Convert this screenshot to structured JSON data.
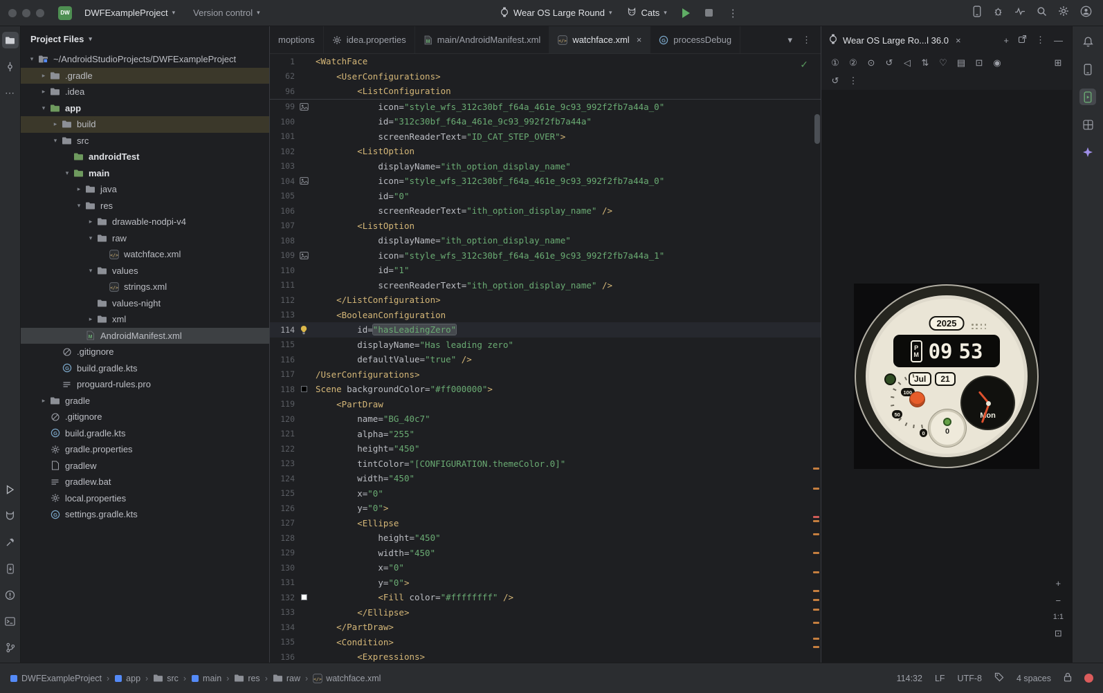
{
  "colors": {
    "accent_blue": "#548af7",
    "run_green": "#5fad65",
    "warning_orange": "#c57e3f",
    "error_red": "#db5c5c",
    "tag_gold": "#d5b778",
    "value_green": "#6aab73"
  },
  "titlebar": {
    "logo_text": "DW",
    "project_name": "DWFExampleProject",
    "vcs_label": "Version control",
    "device_selector_label": "Wear OS Large Round",
    "run_config_label": "Cats"
  },
  "left_strip": {
    "top": [
      {
        "name": "project-tool-icon",
        "active": true
      },
      {
        "name": "commit-tool-icon",
        "active": false
      },
      {
        "name": "more-tool-windows-icon",
        "active": false
      }
    ],
    "bottom": [
      {
        "name": "run-tool-icon"
      },
      {
        "name": "logcat-tool-icon"
      },
      {
        "name": "build-tool-icon"
      },
      {
        "name": "device-explorer-tool-icon"
      },
      {
        "name": "problems-tool-icon"
      },
      {
        "name": "terminal-tool-icon"
      },
      {
        "name": "version-control-tool-icon"
      }
    ]
  },
  "project_panel": {
    "title": "Project Files",
    "tree": [
      {
        "label": "~/AndroidStudioProjects/DWFExampleProject",
        "depth": 0,
        "icon": "project",
        "chev": "down"
      },
      {
        "label": ".gradle",
        "depth": 1,
        "icon": "folder",
        "chev": "right",
        "bg": "excluded"
      },
      {
        "label": ".idea",
        "depth": 1,
        "icon": "folder",
        "chev": "right"
      },
      {
        "label": "app",
        "depth": 1,
        "icon": "folder-green",
        "chev": "down",
        "bold": true
      },
      {
        "label": "build",
        "depth": 2,
        "icon": "folder",
        "chev": "right",
        "bg": "excluded"
      },
      {
        "label": "src",
        "depth": 2,
        "icon": "folder",
        "chev": "down"
      },
      {
        "label": "androidTest",
        "depth": 3,
        "icon": "folder-green",
        "chev": null,
        "bold": true
      },
      {
        "label": "main",
        "depth": 3,
        "icon": "folder-green",
        "chev": "down",
        "bold": true
      },
      {
        "label": "java",
        "depth": 4,
        "icon": "folder",
        "chev": "right"
      },
      {
        "label": "res",
        "depth": 4,
        "icon": "folder",
        "chev": "down"
      },
      {
        "label": "drawable-nodpi-v4",
        "depth": 5,
        "icon": "folder",
        "chev": "right"
      },
      {
        "label": "raw",
        "depth": 5,
        "icon": "folder",
        "chev": "down"
      },
      {
        "label": "watchface.xml",
        "depth": 6,
        "icon": "xml",
        "chev": null
      },
      {
        "label": "values",
        "depth": 5,
        "icon": "folder",
        "chev": "down"
      },
      {
        "label": "strings.xml",
        "depth": 6,
        "icon": "xml",
        "chev": null
      },
      {
        "label": "values-night",
        "depth": 5,
        "icon": "folder",
        "chev": null
      },
      {
        "label": "xml",
        "depth": 5,
        "icon": "folder",
        "chev": "right"
      },
      {
        "label": "AndroidManifest.xml",
        "depth": 4,
        "icon": "manifest",
        "chev": null,
        "bg": "selected"
      },
      {
        "label": ".gitignore",
        "depth": 2,
        "icon": "gitignore",
        "chev": null
      },
      {
        "label": "build.gradle.kts",
        "depth": 2,
        "icon": "gradle",
        "chev": null
      },
      {
        "label": "proguard-rules.pro",
        "depth": 2,
        "icon": "textfile",
        "chev": null
      },
      {
        "label": "gradle",
        "depth": 1,
        "icon": "folder",
        "chev": "right"
      },
      {
        "label": ".gitignore",
        "depth": 1,
        "icon": "gitignore",
        "chev": null
      },
      {
        "label": "build.gradle.kts",
        "depth": 1,
        "icon": "gradle",
        "chev": null
      },
      {
        "label": "gradle.properties",
        "depth": 1,
        "icon": "props",
        "chev": null
      },
      {
        "label": "gradlew",
        "depth": 1,
        "icon": "file",
        "chev": null
      },
      {
        "label": "gradlew.bat",
        "depth": 1,
        "icon": "textfile",
        "chev": null
      },
      {
        "label": "local.properties",
        "depth": 1,
        "icon": "props",
        "chev": null
      },
      {
        "label": "settings.gradle.kts",
        "depth": 1,
        "icon": "gradle",
        "chev": null
      }
    ]
  },
  "tabs": {
    "items": [
      {
        "label": "moptions",
        "icon": null,
        "active": false
      },
      {
        "label": "idea.properties",
        "icon": "props",
        "active": false
      },
      {
        "label": "main/AndroidManifest.xml",
        "icon": "manifest",
        "active": false
      },
      {
        "label": "watchface.xml",
        "icon": "xml",
        "active": true,
        "closable": true
      },
      {
        "label": "processDebug",
        "icon": "gradle",
        "active": false
      }
    ]
  },
  "editor": {
    "sticky_lines": [
      {
        "n": 1,
        "ind": 0,
        "toks": [
          [
            "t",
            "<WatchFace"
          ]
        ]
      },
      {
        "n": 62,
        "ind": 4,
        "toks": [
          [
            "t",
            "<UserConfigurations>"
          ]
        ]
      },
      {
        "n": 96,
        "ind": 8,
        "toks": [
          [
            "t",
            "<ListConfiguration"
          ]
        ]
      }
    ],
    "lines": [
      {
        "n": 99,
        "ind": 12,
        "g": "image",
        "toks": [
          [
            "a",
            "icon="
          ],
          [
            "v",
            "\"style_wfs_312c30bf_f64a_461e_9c93_992f2fb7a44a_0\""
          ]
        ]
      },
      {
        "n": 100,
        "ind": 12,
        "toks": [
          [
            "a",
            "id="
          ],
          [
            "v",
            "\"312c30bf_f64a_461e_9c93_992f2fb7a44a\""
          ]
        ]
      },
      {
        "n": 101,
        "ind": 12,
        "toks": [
          [
            "a",
            "screenReaderText="
          ],
          [
            "v",
            "\"ID_CAT_STEP_OVER\""
          ],
          [
            "t",
            ">"
          ]
        ]
      },
      {
        "n": 102,
        "ind": 8,
        "toks": [
          [
            "t",
            "<ListOption"
          ]
        ]
      },
      {
        "n": 103,
        "ind": 12,
        "toks": [
          [
            "a",
            "displayName="
          ],
          [
            "v",
            "\"ith_option_display_name\""
          ]
        ]
      },
      {
        "n": 104,
        "ind": 12,
        "g": "image",
        "toks": [
          [
            "a",
            "icon="
          ],
          [
            "v",
            "\"style_wfs_312c30bf_f64a_461e_9c93_992f2fb7a44a_0\""
          ]
        ]
      },
      {
        "n": 105,
        "ind": 12,
        "toks": [
          [
            "a",
            "id="
          ],
          [
            "v",
            "\"0\""
          ]
        ]
      },
      {
        "n": 106,
        "ind": 12,
        "toks": [
          [
            "a",
            "screenReaderText="
          ],
          [
            "v",
            "\"ith_option_display_name\""
          ],
          [
            "p",
            " "
          ],
          [
            "t",
            "/>"
          ]
        ]
      },
      {
        "n": 107,
        "ind": 8,
        "toks": [
          [
            "t",
            "<ListOption"
          ]
        ]
      },
      {
        "n": 108,
        "ind": 12,
        "toks": [
          [
            "a",
            "displayName="
          ],
          [
            "v",
            "\"ith_option_display_name\""
          ]
        ]
      },
      {
        "n": 109,
        "ind": 12,
        "g": "image",
        "toks": [
          [
            "a",
            "icon="
          ],
          [
            "v",
            "\"style_wfs_312c30bf_f64a_461e_9c93_992f2fb7a44a_1\""
          ]
        ]
      },
      {
        "n": 110,
        "ind": 12,
        "toks": [
          [
            "a",
            "id="
          ],
          [
            "v",
            "\"1\""
          ]
        ]
      },
      {
        "n": 111,
        "ind": 12,
        "toks": [
          [
            "a",
            "screenReaderText="
          ],
          [
            "v",
            "\"ith_option_display_name\""
          ],
          [
            "p",
            " "
          ],
          [
            "t",
            "/>"
          ]
        ]
      },
      {
        "n": 112,
        "ind": 4,
        "toks": [
          [
            "t",
            "</ListConfiguration>"
          ]
        ]
      },
      {
        "n": 113,
        "ind": 4,
        "toks": [
          [
            "t",
            "<BooleanConfiguration"
          ]
        ]
      },
      {
        "n": 114,
        "ind": 8,
        "g": "bulb",
        "cur": true,
        "toks": [
          [
            "a",
            "id="
          ],
          [
            "h",
            "\"hasLeadingZero\""
          ]
        ]
      },
      {
        "n": 115,
        "ind": 8,
        "toks": [
          [
            "a",
            "displayName="
          ],
          [
            "v",
            "\"Has leading zero\""
          ]
        ]
      },
      {
        "n": 116,
        "ind": 8,
        "toks": [
          [
            "a",
            "defaultValue="
          ],
          [
            "v",
            "\"true\""
          ],
          [
            "p",
            " "
          ],
          [
            "t",
            "/>"
          ]
        ]
      },
      {
        "n": 117,
        "ind": 0,
        "toks": [
          [
            "t",
            "/UserConfigurations>"
          ]
        ]
      },
      {
        "n": 118,
        "ind": 0,
        "g": "sw-black",
        "toks": [
          [
            "t",
            "Scene"
          ],
          [
            "p",
            " "
          ],
          [
            "a",
            "backgroundColor="
          ],
          [
            "v",
            "\"#ff000000\""
          ],
          [
            "t",
            ">"
          ]
        ]
      },
      {
        "n": 119,
        "ind": 4,
        "toks": [
          [
            "t",
            "<PartDraw"
          ]
        ]
      },
      {
        "n": 120,
        "ind": 8,
        "toks": [
          [
            "a",
            "name="
          ],
          [
            "v",
            "\"BG_40c7\""
          ]
        ]
      },
      {
        "n": 121,
        "ind": 8,
        "toks": [
          [
            "a",
            "alpha="
          ],
          [
            "v",
            "\"255\""
          ]
        ]
      },
      {
        "n": 122,
        "ind": 8,
        "toks": [
          [
            "a",
            "height="
          ],
          [
            "v",
            "\"450\""
          ]
        ]
      },
      {
        "n": 123,
        "ind": 8,
        "toks": [
          [
            "a",
            "tintColor="
          ],
          [
            "v",
            "\"[CONFIGURATION.themeColor.0]\""
          ]
        ]
      },
      {
        "n": 124,
        "ind": 8,
        "toks": [
          [
            "a",
            "width="
          ],
          [
            "v",
            "\"450\""
          ]
        ]
      },
      {
        "n": 125,
        "ind": 8,
        "toks": [
          [
            "a",
            "x="
          ],
          [
            "v",
            "\"0\""
          ]
        ]
      },
      {
        "n": 126,
        "ind": 8,
        "toks": [
          [
            "a",
            "y="
          ],
          [
            "v",
            "\"0\""
          ],
          [
            "t",
            ">"
          ]
        ]
      },
      {
        "n": 127,
        "ind": 8,
        "toks": [
          [
            "t",
            "<Ellipse"
          ]
        ]
      },
      {
        "n": 128,
        "ind": 12,
        "toks": [
          [
            "a",
            "height="
          ],
          [
            "v",
            "\"450\""
          ]
        ]
      },
      {
        "n": 129,
        "ind": 12,
        "toks": [
          [
            "a",
            "width="
          ],
          [
            "v",
            "\"450\""
          ]
        ]
      },
      {
        "n": 130,
        "ind": 12,
        "toks": [
          [
            "a",
            "x="
          ],
          [
            "v",
            "\"0\""
          ]
        ]
      },
      {
        "n": 131,
        "ind": 12,
        "toks": [
          [
            "a",
            "y="
          ],
          [
            "v",
            "\"0\""
          ],
          [
            "t",
            ">"
          ]
        ]
      },
      {
        "n": 132,
        "ind": 12,
        "g": "sw-white",
        "toks": [
          [
            "t",
            "<Fill"
          ],
          [
            "p",
            " "
          ],
          [
            "a",
            "color="
          ],
          [
            "v",
            "\"#ffffffff\""
          ],
          [
            "p",
            " "
          ],
          [
            "t",
            "/>"
          ]
        ]
      },
      {
        "n": 133,
        "ind": 8,
        "toks": [
          [
            "t",
            "</Ellipse>"
          ]
        ]
      },
      {
        "n": 134,
        "ind": 4,
        "toks": [
          [
            "t",
            "</PartDraw>"
          ]
        ]
      },
      {
        "n": 135,
        "ind": 4,
        "toks": [
          [
            "t",
            "<Condition>"
          ]
        ]
      },
      {
        "n": 136,
        "ind": 8,
        "toks": [
          [
            "t",
            "<Expressions>"
          ]
        ]
      }
    ]
  },
  "device_panel": {
    "title": "Wear OS Large Ro...l 36.0",
    "controls_row1": [
      {
        "name": "wear-button-1-icon",
        "glyph": "①"
      },
      {
        "name": "wear-button-2-icon",
        "glyph": "②"
      },
      {
        "name": "wear-palm-icon",
        "glyph": "⊙"
      },
      {
        "name": "rotate-left-icon",
        "glyph": "↺"
      },
      {
        "name": "back-icon",
        "glyph": "◁"
      },
      {
        "name": "tilt-icon",
        "glyph": "⇅"
      },
      {
        "name": "heart-rate-icon",
        "glyph": "♡"
      },
      {
        "name": "overlays-icon",
        "glyph": "▤"
      },
      {
        "name": "camera-icon",
        "glyph": "⊡"
      },
      {
        "name": "screen-record-icon",
        "glyph": "◉"
      }
    ],
    "controls_row1_right": {
      "name": "screenshot-icon",
      "glyph": "⊞"
    },
    "controls_row2": [
      {
        "name": "reset-view-icon",
        "glyph": "↺"
      },
      {
        "name": "more-options-icon",
        "glyph": "⋮"
      }
    ],
    "zoom_label": "1:1",
    "watch": {
      "year": "2025",
      "ampm": [
        "P",
        "M"
      ],
      "hour": "09",
      "minute": "53",
      "month": "Jul",
      "day": "21",
      "weekday": "Mon",
      "gauge_top": "100",
      "gauge_mid": "50",
      "gauge_bottom": "0",
      "subdial_value": "0"
    }
  },
  "right_strip": {
    "items": [
      {
        "name": "notifications-icon",
        "active": false
      },
      {
        "name": "device-manager-icon",
        "active": false
      },
      {
        "name": "running-devices-icon",
        "active": true
      },
      {
        "name": "layout-inspector-icon",
        "active": false
      },
      {
        "name": "gemini-icon",
        "active": false
      }
    ]
  },
  "status_bar": {
    "breadcrumbs": [
      {
        "label": "DWFExampleProject",
        "icon": "module"
      },
      {
        "label": "app",
        "icon": "module"
      },
      {
        "label": "src",
        "icon": "folder"
      },
      {
        "label": "main",
        "icon": "module"
      },
      {
        "label": "res",
        "icon": "folder"
      },
      {
        "label": "raw",
        "icon": "folder"
      },
      {
        "label": "watchface.xml",
        "icon": "xml"
      }
    ],
    "caret_position": "114:32",
    "line_ending": "LF",
    "encoding": "UTF-8",
    "indent_info": "4 spaces"
  }
}
